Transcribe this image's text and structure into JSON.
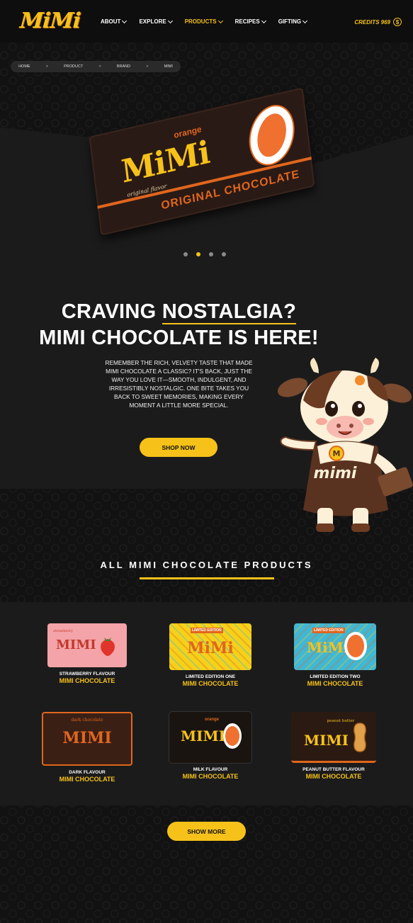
{
  "brand": {
    "logo": "MiMi"
  },
  "nav": {
    "items": [
      {
        "label": "ABOUT"
      },
      {
        "label": "EXPLORE"
      },
      {
        "label": "PRODUCTS"
      },
      {
        "label": "RECIPES"
      },
      {
        "label": "GIFTING"
      }
    ],
    "active": "PRODUCTS",
    "credits_label": "CREDITS 969",
    "coin_symbol": "$"
  },
  "breadcrumb": [
    "HOME",
    "PRODUCT",
    "BRAND",
    "MIMI"
  ],
  "breadcrumb_sep": ">",
  "hero_bar": {
    "flavor_word": "orange",
    "logo": "MiMi",
    "subline": "original flavor",
    "bottom_text": "ORIGINAL CHOCOLATE"
  },
  "carousel": {
    "count": 4,
    "active_index": 1
  },
  "headline": {
    "line1_a": "CRAVING ",
    "line1_b": "NOSTALGIA?",
    "line2": "MIMI CHOCOLATE IS HERE!"
  },
  "hero_text": "REMEMBER THE RICH, VELVETY TASTE THAT MADE MIMI CHOCOLATE A CLASSIC? IT'S BACK, JUST THE WAY YOU LOVE IT—SMOOTH, INDULGENT, AND IRRESISTIBLY NOSTALGIC. ONE BITE TAKES YOU BACK TO SWEET MEMORIES, MAKING EVERY MOMENT A LITTLE MORE SPECIAL.",
  "shop_now": "SHOP NOW",
  "mascot_text": "mimi",
  "mascot_badge": "M",
  "products_title": "ALL MIMI CHOCOLATE PRODUCTS",
  "products": [
    {
      "line1": "STRAWBERRY FLAVOUR",
      "line2": "MIMI CHOCOLATE",
      "pack_text": "MIMI",
      "pack_sub": "strawberry",
      "color": "#f4a3a8",
      "logo_color": "#c0392b"
    },
    {
      "line1": "LIMITED EDITION ONE",
      "line2": "MIMI CHOCOLATE",
      "pack_text": "MiMi",
      "pack_sub": "LIMITED EDITION",
      "color": "#f6d11a",
      "logo_color": "#e0661e"
    },
    {
      "line1": "LIMITED EDITION TWO",
      "line2": "MIMI CHOCOLATE",
      "pack_text": "MiMi",
      "pack_sub": "LIMITED EDITION",
      "color": "#3fb8d6",
      "logo_color": "#f6c21a"
    },
    {
      "line1": "DARK FLAVOUR",
      "line2": "MIMI CHOCOLATE",
      "pack_text": "MIMI",
      "pack_sub": "dark chocolate",
      "color": "#3a1f15",
      "logo_color": "#e0661e"
    },
    {
      "line1": "MILK FLAVOUR",
      "line2": "MIMI CHOCOLATE",
      "pack_text": "MIMI",
      "pack_sub": "orange",
      "color": "#1a1411",
      "logo_color": "#f6c21a"
    },
    {
      "line1": "PEANUT BUTTER FLAVOUR",
      "line2": "MIMI CHOCOLATE",
      "pack_text": "MIMI",
      "pack_sub": "peanut butter",
      "color": "#2b1a12",
      "logo_color": "#f6c21a"
    }
  ],
  "show_more": "SHOW MORE",
  "colors": {
    "accent": "#f6c21a",
    "orange": "#e0661e",
    "bg": "#121212"
  }
}
